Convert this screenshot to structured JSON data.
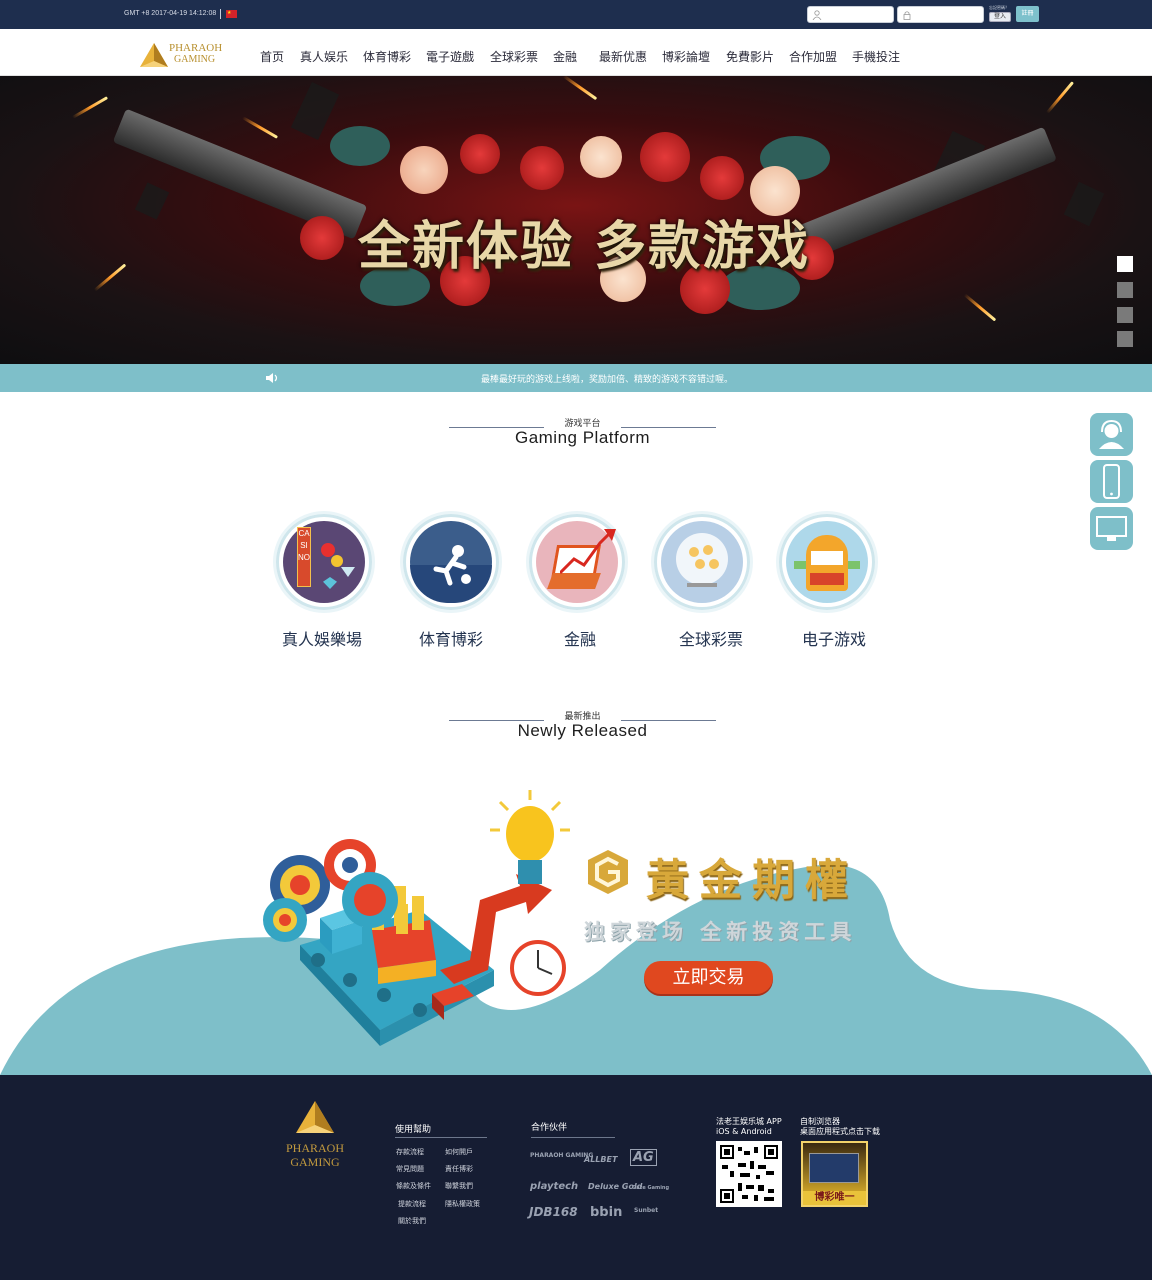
{
  "topbar": {
    "time": "GMT +8 2017-04-19 14:12:08",
    "username_placeholder": "",
    "password_placeholder": "",
    "forgot_label": "忘記密碼？",
    "login_label": "登入",
    "register_label": "註冊",
    "flag_glyph": "★"
  },
  "logo": {
    "line1": "PHARAOH",
    "line2": "GAMING"
  },
  "nav": [
    "首页",
    "真人娱乐",
    "体育博彩",
    "電子遊戲",
    "全球彩票",
    "金融",
    "最新优惠",
    "博彩論壇",
    "免費影片",
    "合作加盟",
    "手機投注"
  ],
  "banner": {
    "headline": "全新体验 多款游戏",
    "slides": 4,
    "active_slide": 1
  },
  "marquee": {
    "text": "最棒最好玩的游戏上线啦，奖励加倍、精致的游戏不容错过喔。"
  },
  "side_buttons": [
    "customer-service",
    "mobile",
    "desktop"
  ],
  "platform": {
    "title_cn": "游戏平台",
    "title_en": "Gaming Platform",
    "items": [
      {
        "label": "真人娛樂場",
        "icon": "casino-icon"
      },
      {
        "label": "体育博彩",
        "icon": "soccer-icon"
      },
      {
        "label": "金融",
        "icon": "finance-chart-icon"
      },
      {
        "label": "全球彩票",
        "icon": "lottery-icon"
      },
      {
        "label": "电子游戏",
        "icon": "slot-machine-icon"
      }
    ],
    "casino_sign": "CASINO"
  },
  "released": {
    "title_cn": "最新推出",
    "title_en": "Newly Released",
    "promo_title": "黃金期權",
    "promo_sub": "独家登场 全新投资工具",
    "promo_button": "立即交易"
  },
  "footer": {
    "logo_line1": "PHARAOH",
    "logo_line2": "GAMING",
    "help_title": "使用幫助",
    "help_links": [
      "存款流程",
      "如何開戶",
      "常見問題",
      "責任博彩",
      "條款及條件",
      "聯繫我們",
      "提款流程",
      "隱私權政策",
      "關於我們"
    ],
    "partners_title": "合作伙伴",
    "partners": [
      "PHARAOH GAMING",
      "ALLBET",
      "AG",
      "playtech",
      "Deluxe Gold",
      "Gaze Gaming",
      "JDB168",
      "bbin",
      "Sunbet"
    ],
    "app_title_1": "法老王娱乐城 APP",
    "app_title_2": "iOS & Android",
    "desk_title_1": "自制浏览器",
    "desk_title_2": "桌面应用程式点击下载",
    "desk_img_text": "博彩唯一"
  },
  "colors": {
    "navy": "#1e2e4e",
    "teal": "#7ebfc9",
    "gold": "#d8a83a",
    "orange": "#e0481f",
    "footer": "#161d33"
  }
}
